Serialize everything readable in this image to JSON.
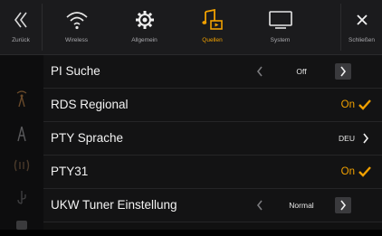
{
  "tabs": [
    {
      "id": "back",
      "label": "Zurück",
      "icon": "chevrons-left-icon"
    },
    {
      "id": "wireless",
      "label": "Wireless",
      "icon": "wifi-icon"
    },
    {
      "id": "allgemein",
      "label": "Allgemein",
      "icon": "gear-icon"
    },
    {
      "id": "quellen",
      "label": "Quellen",
      "icon": "music-source-icon",
      "active": true
    },
    {
      "id": "system",
      "label": "System",
      "icon": "monitor-icon"
    },
    {
      "id": "close",
      "label": "Schließen",
      "icon": "close-icon"
    }
  ],
  "side_icons": [
    "antenna-icon",
    "antenna-tower-icon",
    "dab-wave-icon",
    "usb-icon",
    "hdmi-icon"
  ],
  "rows": [
    {
      "title": "PI Suche",
      "type": "stepper",
      "value": "Off"
    },
    {
      "title": "RDS Regional",
      "type": "toggle",
      "value": "On"
    },
    {
      "title": "PTY Sprache",
      "type": "link",
      "value": "DEU"
    },
    {
      "title": "PTY31",
      "type": "toggle",
      "value": "On"
    },
    {
      "title": "UKW Tuner Einstellung",
      "type": "stepper",
      "value": "Normal"
    }
  ],
  "colors": {
    "accent": "#f0a000",
    "background": "#111111",
    "tabbar": "#1b1b1d"
  }
}
